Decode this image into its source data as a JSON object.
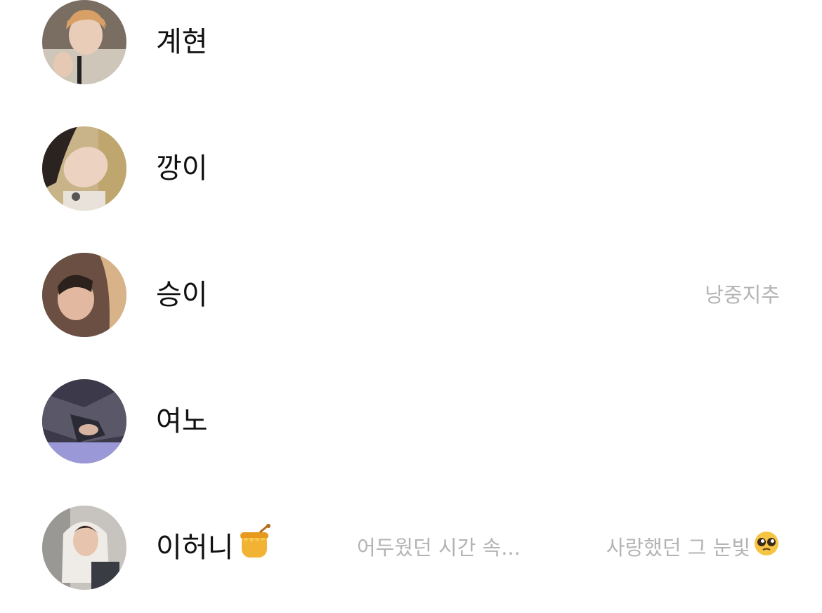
{
  "contacts": [
    {
      "name": "계현",
      "status": "",
      "avatar_icon": "profile-photo"
    },
    {
      "name": "깡이",
      "status": "",
      "avatar_icon": "profile-photo"
    },
    {
      "name": "승이",
      "status": "낭중지추",
      "avatar_icon": "profile-photo"
    },
    {
      "name": "여노",
      "status": "",
      "avatar_icon": "profile-photo"
    },
    {
      "name": "이허니",
      "name_emoji": "honey-pot-icon",
      "music": "어두웠던 시간 속...",
      "status": "사랑했던 그 눈빛",
      "status_emoji": "pleading-face-icon",
      "avatar_icon": "profile-photo"
    }
  ],
  "colors": {
    "name_text": "#111111",
    "status_text": "#b3b3b3",
    "background": "#ffffff"
  }
}
